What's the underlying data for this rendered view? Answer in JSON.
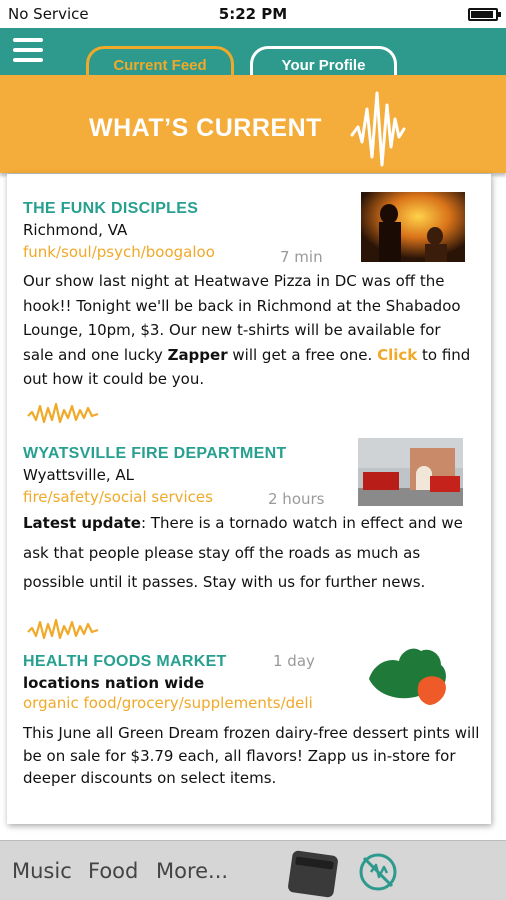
{
  "status": {
    "carrier": "No Service",
    "time": "5:22 PM",
    "battery_level": 0.9
  },
  "tabs": {
    "current": "Current Feed",
    "profile": "Your Profile"
  },
  "banner": {
    "title": "WHAT’S CURRENT"
  },
  "posts": [
    {
      "title": "THE FUNK DISCIPLES",
      "location": "Richmond, VA",
      "tags": "funk/soul/psych/boogaloo",
      "time": "7 min",
      "body_a": "Our show last night at Heatwave Pizza in DC was off the hook!! Tonight we'll be back in Richmond at the Shabadoo Lounge, 10pm, $3. Our new t-shirts will be available for sale and one lucky ",
      "body_bold": "Zapper",
      "body_b": " will get a free one. ",
      "body_link": "Click",
      "body_c": " to find out how it could be you."
    },
    {
      "title": "WYATSVILLE FIRE DEPARTMENT",
      "location": "Wyattsville, AL",
      "tags": "fire/safety/social services",
      "time": "2 hours",
      "body_bold": "Latest update",
      "body_a": ": There is a tornado watch in effect and we ask that people please stay off the roads as much as possible until it passes. Stay with us for further news."
    },
    {
      "title": "HEALTH FOODS MARKET",
      "location": "locations nation wide",
      "tags": "organic food/grocery/supplements/deli",
      "time": "1 day",
      "body_a": "This June all Green Dream frozen dairy-free dessert pints will be on sale for $3.79 each, all flavors! Zapp us in-store for deeper discounts on select items."
    }
  ],
  "bottom_nav": {
    "music": "Music",
    "food": "Food",
    "more": "More..."
  },
  "colors": {
    "teal": "#2e9a8e",
    "orange": "#f4ac3a",
    "tag_orange": "#f0a929"
  },
  "icons": [
    "menu-icon",
    "wave-icon",
    "wallet-icon",
    "zap-icon",
    "leaf-icon"
  ]
}
